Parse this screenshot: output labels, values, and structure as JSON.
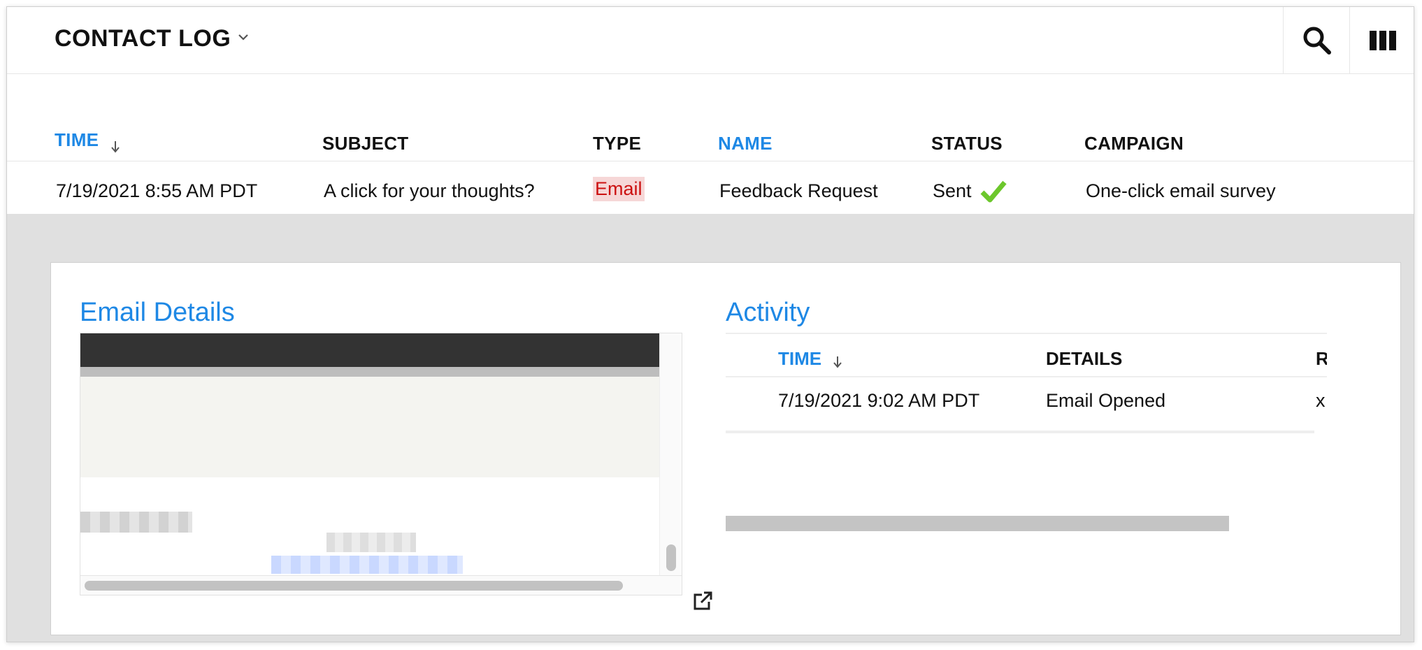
{
  "header": {
    "title": "CONTACT LOG",
    "title_dropdown_icon": "chevron-down-icon",
    "search_icon": "search-icon",
    "columns_icon": "columns-icon"
  },
  "table": {
    "columns": {
      "time": "TIME",
      "subject": "SUBJECT",
      "type": "TYPE",
      "name": "NAME",
      "status": "STATUS",
      "campaign": "CAMPAIGN"
    },
    "sort_icon": "arrow-down-icon",
    "row": {
      "time": "7/19/2021 8:55 AM PDT",
      "subject": "A click for your thoughts?",
      "type": "Email",
      "name": "Feedback Request",
      "status": "Sent",
      "status_icon": "checkmark-icon",
      "campaign": "One-click email survey"
    }
  },
  "details": {
    "email_title": "Email Details",
    "activity_title": "Activity",
    "popout_icon": "external-link-icon",
    "activity_columns": {
      "time": "TIME",
      "details": "DETAILS",
      "third": "R"
    },
    "activity_row": {
      "time": "7/19/2021 9:02 AM PDT",
      "details": "Email Opened",
      "third": "x"
    }
  },
  "colors": {
    "accent": "#1e88e5",
    "type_badge_bg": "#f6d7d7",
    "type_badge_text": "#cc1111",
    "check_green": "#6cc72c",
    "panel_bg": "#e0e0e0"
  }
}
